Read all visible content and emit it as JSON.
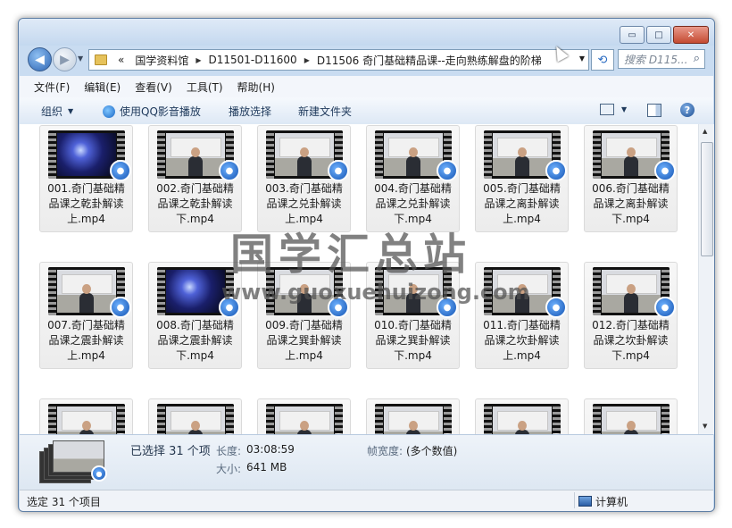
{
  "window": {
    "controls": {
      "minimize": "▭",
      "maximize": "□",
      "close": "✕"
    }
  },
  "nav": {
    "back_icon": "◀",
    "forward_icon": "▶",
    "address": {
      "overflow": "«",
      "crumbs": [
        "国学资料馆",
        "D11501-D11600",
        "D11506 奇门基础精品课--走向熟练解盘的阶梯"
      ]
    },
    "search_placeholder": "搜索 D115...",
    "search_icon": "⌕"
  },
  "menu": [
    "文件(F)",
    "编辑(E)",
    "查看(V)",
    "工具(T)",
    "帮助(H)"
  ],
  "toolbar": {
    "organize": "组织",
    "play_qq": "使用QQ影音播放",
    "play_selection": "播放选择",
    "new_folder": "新建文件夹"
  },
  "files": [
    {
      "label": "001.奇门基础精品课之乾卦解读上.mp4",
      "thumb": "space"
    },
    {
      "label": "002.奇门基础精品课之乾卦解读下.mp4",
      "thumb": "room"
    },
    {
      "label": "003.奇门基础精品课之兑卦解读上.mp4",
      "thumb": "room"
    },
    {
      "label": "004.奇门基础精品课之兑卦解读下.mp4",
      "thumb": "room"
    },
    {
      "label": "005.奇门基础精品课之离卦解读上.mp4",
      "thumb": "room"
    },
    {
      "label": "006.奇门基础精品课之离卦解读下.mp4",
      "thumb": "room"
    },
    {
      "label": "007.奇门基础精品课之震卦解读上.mp4",
      "thumb": "room"
    },
    {
      "label": "008.奇门基础精品课之震卦解读下.mp4",
      "thumb": "space"
    },
    {
      "label": "009.奇门基础精品课之巽卦解读上.mp4",
      "thumb": "room"
    },
    {
      "label": "010.奇门基础精品课之巽卦解读下.mp4",
      "thumb": "room"
    },
    {
      "label": "011.奇门基础精品课之坎卦解读上.mp4",
      "thumb": "room"
    },
    {
      "label": "012.奇门基础精品课之坎卦解读下.mp4",
      "thumb": "room"
    },
    {
      "label": "",
      "thumb": "room"
    },
    {
      "label": "",
      "thumb": "room"
    },
    {
      "label": "",
      "thumb": "room"
    },
    {
      "label": "",
      "thumb": "room"
    },
    {
      "label": "",
      "thumb": "room"
    },
    {
      "label": "",
      "thumb": "room"
    }
  ],
  "details": {
    "selected": "已选择 31 个项",
    "length_label": "长度:",
    "length_value": "03:08:59",
    "size_label": "大小:",
    "size_value": "641 MB",
    "framewidth_label": "帧宽度:",
    "framewidth_value": "(多个数值)"
  },
  "status": {
    "left": "选定 31 个项目",
    "right": "计算机"
  },
  "watermark": {
    "title": "国学汇总站",
    "url": "www.guoxuehuizong.com"
  }
}
